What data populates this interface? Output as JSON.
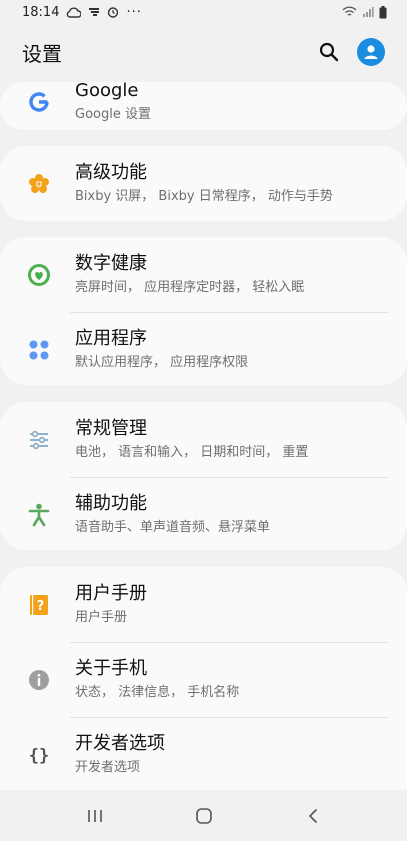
{
  "status_bar": {
    "time": "18:14",
    "notification_icons": [
      "cloud-icon",
      "sync-icon",
      "timer-icon"
    ],
    "more": "···",
    "right_icons": [
      "wifi-icon",
      "signal-icon",
      "battery-icon"
    ]
  },
  "app_bar": {
    "title": "设置",
    "search_icon": "search-icon",
    "profile_icon": "account-icon"
  },
  "sections": [
    {
      "items": [
        {
          "title": "Google",
          "subtitle": "Google 设置",
          "icon": "google-icon",
          "color": "#4285f4"
        }
      ]
    },
    {
      "items": [
        {
          "title": "高级功能",
          "subtitle": "Bixby 识屏， Bixby 日常程序， 动作与手势",
          "icon": "advanced-features-icon",
          "color": "#f4a21b"
        }
      ]
    },
    {
      "items": [
        {
          "title": "数字健康",
          "subtitle": "亮屏时间， 应用程序定时器， 轻松入眠",
          "icon": "digital-wellbeing-icon",
          "color": "#4caf50"
        },
        {
          "title": "应用程序",
          "subtitle": "默认应用程序， 应用程序权限",
          "icon": "apps-icon",
          "color": "#5e97f6"
        }
      ]
    },
    {
      "items": [
        {
          "title": "常规管理",
          "subtitle": "电池， 语言和输入， 日期和时间， 重置",
          "icon": "general-management-icon",
          "color": "#8fb3c7"
        },
        {
          "title": "辅助功能",
          "subtitle": "语音助手、单声道音频、悬浮菜单",
          "icon": "accessibility-icon",
          "color": "#5aa65e"
        }
      ]
    },
    {
      "items": [
        {
          "title": "用户手册",
          "subtitle": "用户手册",
          "icon": "user-manual-icon",
          "color": "#f4a21b"
        },
        {
          "title": "关于手机",
          "subtitle": "状态， 法律信息， 手机名称",
          "icon": "info-icon",
          "color": "#9e9e9e"
        },
        {
          "title": "开发者选项",
          "subtitle": "开发者选项",
          "icon": "developer-options-icon",
          "color": "#555555"
        }
      ]
    }
  ],
  "nav_bar": {
    "recents_icon": "recents-icon",
    "home_icon": "home-icon",
    "back_icon": "back-icon"
  },
  "colors": {
    "background": "#f1f1f1",
    "card": "#fafafa",
    "accent": "#1a8de1"
  }
}
